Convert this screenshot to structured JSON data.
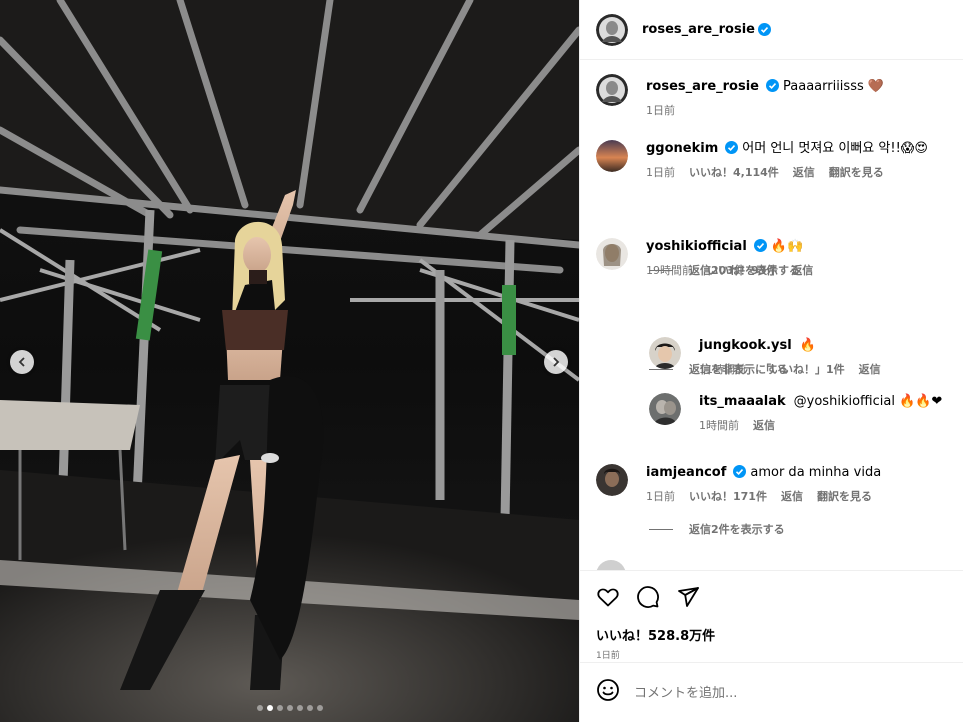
{
  "post": {
    "author": "roses_are_rosie",
    "caption": "Paaaarriiisss 🤎",
    "caption_time": "1日前"
  },
  "media": {
    "dots_count": 7,
    "active_index": 1
  },
  "comments": [
    {
      "user": "ggonekim",
      "text": "어머 언니 멋져요 이뻐요 악!!😱😍",
      "time": "1日前",
      "likes": "いいね！4,114件",
      "reply": "返信",
      "translate": "翻訳を見る",
      "replies_toggle": "返信203件を表示する"
    },
    {
      "user": "yoshikiofficial",
      "text": "🔥🙌",
      "time": "19時間前",
      "likes": "いいね！93件",
      "reply": "返信",
      "replies_toggle": "返信を非表示にする"
    },
    {
      "user": "jungkook.ysl",
      "text": "🔥",
      "time": "11時間前",
      "likes": "「いいね！」1件",
      "reply": "返信"
    },
    {
      "user": "its_maaalak",
      "text": "@yoshikiofficial 🔥🔥❤",
      "time": "1時間前",
      "reply": "返信"
    },
    {
      "user": "iamjeancof",
      "text": "amor da minha vida",
      "time": "1日前",
      "likes": "いいね！171件",
      "reply": "返信",
      "translate": "翻訳を見る",
      "replies_toggle": "返信2件を表示する"
    }
  ],
  "actions": {
    "likes": "いいね！528.8万件",
    "time": "1日前"
  },
  "add_comment": {
    "placeholder": "コメントを追加..."
  },
  "colors": {
    "verified": "#0095f6",
    "muted": "#737373",
    "border": "#efefef"
  },
  "icons": [
    "chevron-left-icon",
    "chevron-right-icon",
    "heart-icon",
    "comment-icon",
    "share-icon",
    "emoji-icon",
    "verified-icon"
  ]
}
